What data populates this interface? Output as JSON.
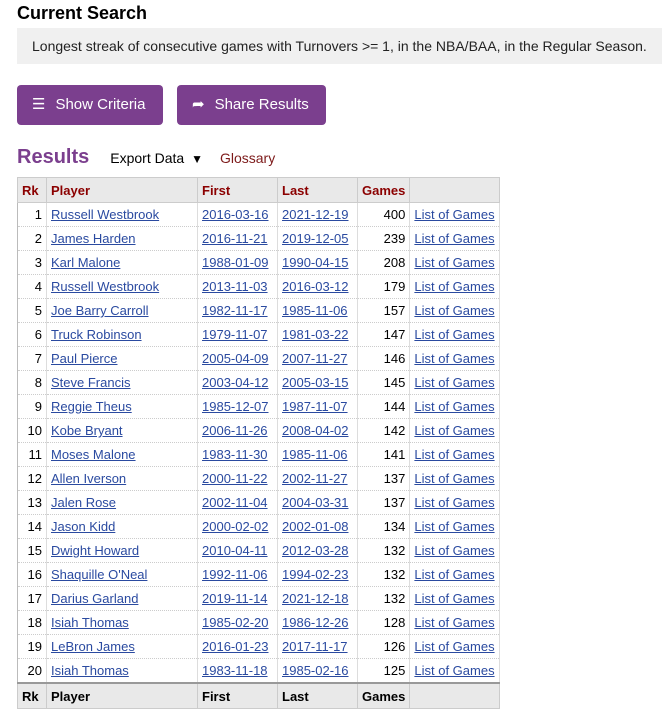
{
  "header": {
    "title": "Current Search"
  },
  "criteria": {
    "text": "Longest streak of consecutive games with Turnovers >= 1, in the NBA/BAA, in the Regular Season."
  },
  "buttons": {
    "show_criteria": "Show Criteria",
    "share_results": "Share Results"
  },
  "results": {
    "title": "Results",
    "export_label": "Export Data",
    "export_caret": "▼",
    "glossary_label": "Glossary"
  },
  "table": {
    "columns": [
      "Rk",
      "Player",
      "First",
      "Last",
      "Games",
      ""
    ],
    "rows": [
      [
        "1",
        "Russell Westbrook",
        "2016-03-16",
        "2021-12-19",
        "400",
        "List of Games"
      ],
      [
        "2",
        "James Harden",
        "2016-11-21",
        "2019-12-05",
        "239",
        "List of Games"
      ],
      [
        "3",
        "Karl Malone",
        "1988-01-09",
        "1990-04-15",
        "208",
        "List of Games"
      ],
      [
        "4",
        "Russell Westbrook",
        "2013-11-03",
        "2016-03-12",
        "179",
        "List of Games"
      ],
      [
        "5",
        "Joe Barry Carroll",
        "1982-11-17",
        "1985-11-06",
        "157",
        "List of Games"
      ],
      [
        "6",
        "Truck Robinson",
        "1979-11-07",
        "1981-03-22",
        "147",
        "List of Games"
      ],
      [
        "7",
        "Paul Pierce",
        "2005-04-09",
        "2007-11-27",
        "146",
        "List of Games"
      ],
      [
        "8",
        "Steve Francis",
        "2003-04-12",
        "2005-03-15",
        "145",
        "List of Games"
      ],
      [
        "9",
        "Reggie Theus",
        "1985-12-07",
        "1987-11-07",
        "144",
        "List of Games"
      ],
      [
        "10",
        "Kobe Bryant",
        "2006-11-26",
        "2008-04-02",
        "142",
        "List of Games"
      ],
      [
        "11",
        "Moses Malone",
        "1983-11-30",
        "1985-11-06",
        "141",
        "List of Games"
      ],
      [
        "12",
        "Allen Iverson",
        "2000-11-22",
        "2002-11-27",
        "137",
        "List of Games"
      ],
      [
        "13",
        "Jalen Rose",
        "2002-11-04",
        "2004-03-31",
        "137",
        "List of Games"
      ],
      [
        "14",
        "Jason Kidd",
        "2000-02-02",
        "2002-01-08",
        "134",
        "List of Games"
      ],
      [
        "15",
        "Dwight Howard",
        "2010-04-11",
        "2012-03-28",
        "132",
        "List of Games"
      ],
      [
        "16",
        "Shaquille O'Neal",
        "1992-11-06",
        "1994-02-23",
        "132",
        "List of Games"
      ],
      [
        "17",
        "Darius Garland",
        "2019-11-14",
        "2021-12-18",
        "132",
        "List of Games"
      ],
      [
        "18",
        "Isiah Thomas",
        "1985-02-20",
        "1986-12-26",
        "128",
        "List of Games"
      ],
      [
        "19",
        "LeBron James",
        "2016-01-23",
        "2017-11-17",
        "126",
        "List of Games"
      ],
      [
        "20",
        "Isiah Thomas",
        "1983-11-18",
        "1985-02-16",
        "125",
        "List of Games"
      ]
    ]
  },
  "colors": {
    "accent": "#7b3f8e",
    "link": "#2a4aa0",
    "header_text": "#8b0000",
    "glossary": "#7d1a1a"
  },
  "icons": {
    "show_criteria": "hamburger-icon",
    "share_results": "share-arrow-icon"
  }
}
